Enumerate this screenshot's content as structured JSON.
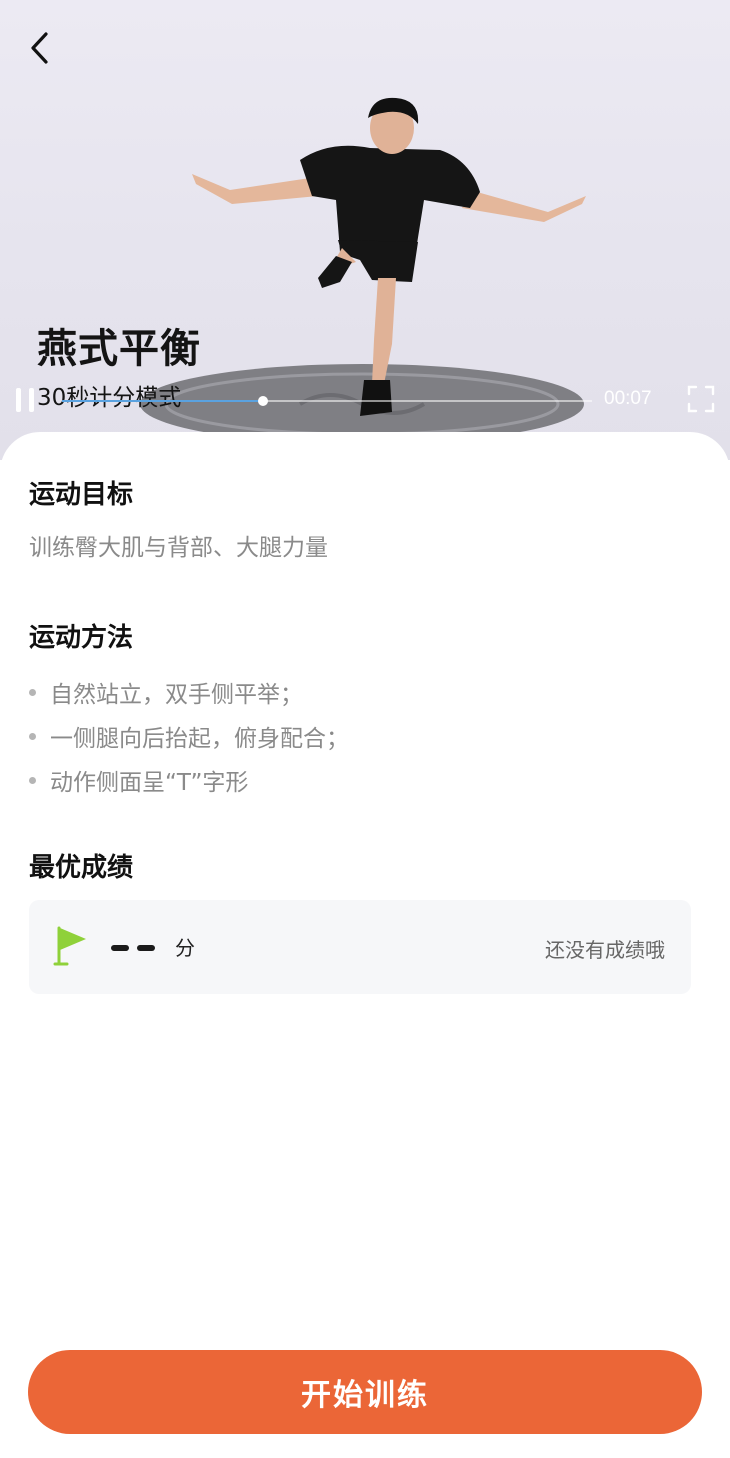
{
  "video": {
    "title": "燕式平衡",
    "subtitle": "30秒计分模式",
    "time": "00:07",
    "progress": 0.38
  },
  "sections": {
    "goal_title": "运动目标",
    "goal_text": "训练臀大肌与背部、大腿力量",
    "method_title": "运动方法",
    "method_items": [
      "自然站立，双手侧平举；",
      "一侧腿向后抬起，俯身配合；",
      "动作侧面呈“T”字形"
    ],
    "best_title": "最优成绩"
  },
  "score": {
    "unit": "分",
    "empty_text": "还没有成绩哦"
  },
  "actions": {
    "start_label": "开始训练"
  },
  "colors": {
    "accent": "#eb6637",
    "flag": "#8fd13a",
    "progress": "#5aa2e0"
  },
  "icons": [
    "back-arrow-icon",
    "pause-icon",
    "fullscreen-icon",
    "flag-icon"
  ]
}
